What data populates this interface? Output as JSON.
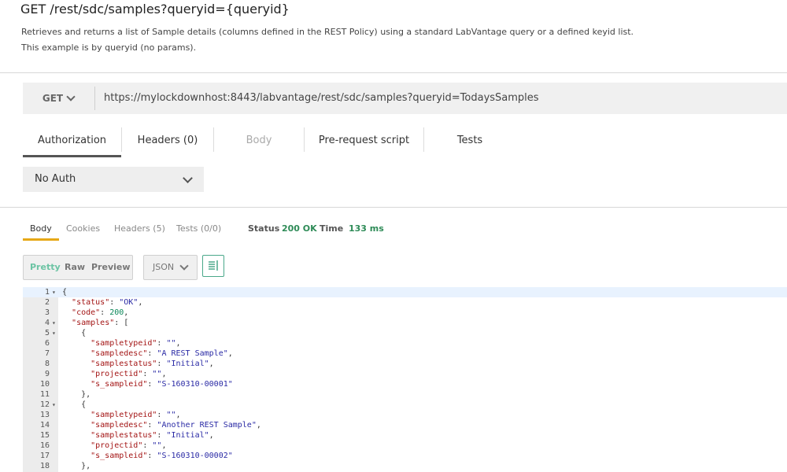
{
  "header": {
    "title": "GET /rest/sdc/samples?queryid={queryid}",
    "description_line1": "Retrieves and returns a list of Sample details (columns defined in the REST Policy) using a standard LabVantage query or a defined keyid list.",
    "description_line2": "This example is by queryid (no params)."
  },
  "request": {
    "method": "GET",
    "url": "https://mylockdownhost:8443/labvantage/rest/sdc/samples?queryid=TodaysSamples"
  },
  "request_tabs": [
    {
      "label": "Authorization",
      "active": true
    },
    {
      "label": "Headers (0)"
    },
    {
      "label": "Body",
      "disabled": true
    },
    {
      "label": "Pre-request script"
    },
    {
      "label": "Tests"
    }
  ],
  "auth": {
    "selected": "No Auth"
  },
  "response_tabs": [
    "Body",
    "Cookies",
    "Headers (5)",
    "Tests (0/0)"
  ],
  "status": {
    "status_label": "Status",
    "status_value": "200 OK",
    "time_label": "Time",
    "time_value": "133 ms"
  },
  "view_modes": [
    "Pretty",
    "Raw",
    "Preview"
  ],
  "format": "JSON",
  "code_lines": [
    {
      "n": "1",
      "fold": true,
      "indent": 0,
      "tokens": [
        [
          "p",
          "{"
        ]
      ]
    },
    {
      "n": "2",
      "fold": false,
      "indent": 1,
      "tokens": [
        [
          "k",
          "\"status\""
        ],
        [
          "p",
          ": "
        ],
        [
          "s",
          "\"OK\""
        ],
        [
          "p",
          ","
        ]
      ]
    },
    {
      "n": "3",
      "fold": false,
      "indent": 1,
      "tokens": [
        [
          "k",
          "\"code\""
        ],
        [
          "p",
          ": "
        ],
        [
          "n",
          "200"
        ],
        [
          "p",
          ","
        ]
      ]
    },
    {
      "n": "4",
      "fold": true,
      "indent": 1,
      "tokens": [
        [
          "k",
          "\"samples\""
        ],
        [
          "p",
          ": ["
        ]
      ]
    },
    {
      "n": "5",
      "fold": true,
      "indent": 2,
      "tokens": [
        [
          "p",
          "{"
        ]
      ]
    },
    {
      "n": "6",
      "fold": false,
      "indent": 3,
      "tokens": [
        [
          "k",
          "\"sampletypeid\""
        ],
        [
          "p",
          ": "
        ],
        [
          "s",
          "\"\""
        ],
        [
          "p",
          ","
        ]
      ]
    },
    {
      "n": "7",
      "fold": false,
      "indent": 3,
      "tokens": [
        [
          "k",
          "\"sampledesc\""
        ],
        [
          "p",
          ": "
        ],
        [
          "s",
          "\"A REST Sample\""
        ],
        [
          "p",
          ","
        ]
      ]
    },
    {
      "n": "8",
      "fold": false,
      "indent": 3,
      "tokens": [
        [
          "k",
          "\"samplestatus\""
        ],
        [
          "p",
          ": "
        ],
        [
          "s",
          "\"Initial\""
        ],
        [
          "p",
          ","
        ]
      ]
    },
    {
      "n": "9",
      "fold": false,
      "indent": 3,
      "tokens": [
        [
          "k",
          "\"projectid\""
        ],
        [
          "p",
          ": "
        ],
        [
          "s",
          "\"\""
        ],
        [
          "p",
          ","
        ]
      ]
    },
    {
      "n": "10",
      "fold": false,
      "indent": 3,
      "tokens": [
        [
          "k",
          "\"s_sampleid\""
        ],
        [
          "p",
          ": "
        ],
        [
          "s",
          "\"S-160310-00001\""
        ]
      ]
    },
    {
      "n": "11",
      "fold": false,
      "indent": 2,
      "tokens": [
        [
          "p",
          "},"
        ]
      ]
    },
    {
      "n": "12",
      "fold": true,
      "indent": 2,
      "tokens": [
        [
          "p",
          "{"
        ]
      ]
    },
    {
      "n": "13",
      "fold": false,
      "indent": 3,
      "tokens": [
        [
          "k",
          "\"sampletypeid\""
        ],
        [
          "p",
          ": "
        ],
        [
          "s",
          "\"\""
        ],
        [
          "p",
          ","
        ]
      ]
    },
    {
      "n": "14",
      "fold": false,
      "indent": 3,
      "tokens": [
        [
          "k",
          "\"sampledesc\""
        ],
        [
          "p",
          ": "
        ],
        [
          "s",
          "\"Another REST Sample\""
        ],
        [
          "p",
          ","
        ]
      ]
    },
    {
      "n": "15",
      "fold": false,
      "indent": 3,
      "tokens": [
        [
          "k",
          "\"samplestatus\""
        ],
        [
          "p",
          ": "
        ],
        [
          "s",
          "\"Initial\""
        ],
        [
          "p",
          ","
        ]
      ]
    },
    {
      "n": "16",
      "fold": false,
      "indent": 3,
      "tokens": [
        [
          "k",
          "\"projectid\""
        ],
        [
          "p",
          ": "
        ],
        [
          "s",
          "\"\""
        ],
        [
          "p",
          ","
        ]
      ]
    },
    {
      "n": "17",
      "fold": false,
      "indent": 3,
      "tokens": [
        [
          "k",
          "\"s_sampleid\""
        ],
        [
          "p",
          ": "
        ],
        [
          "s",
          "\"S-160310-00002\""
        ]
      ]
    },
    {
      "n": "18",
      "fold": false,
      "indent": 2,
      "tokens": [
        [
          "p",
          "},"
        ]
      ]
    }
  ]
}
